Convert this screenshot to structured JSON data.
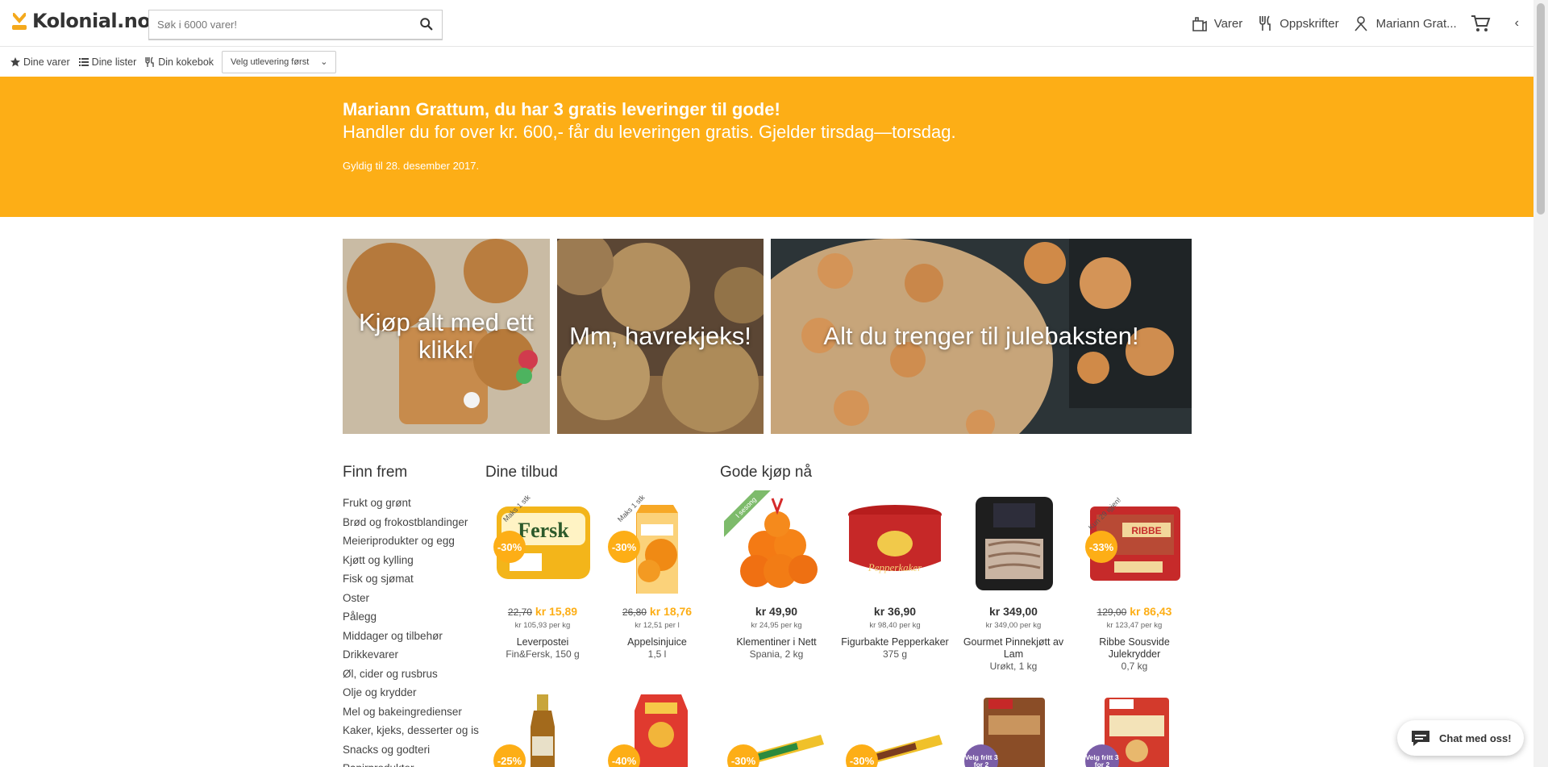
{
  "header": {
    "logo_text": "Kolonial.no",
    "search_placeholder": "Søk i 6000 varer!",
    "nav": [
      {
        "label": "Varer",
        "icon": "grocery-bag-icon"
      },
      {
        "label": "Oppskrifter",
        "icon": "fork-knife-icon"
      },
      {
        "label": "Mariann Grat...",
        "icon": "user-icon"
      }
    ]
  },
  "subbar": {
    "items": [
      "Dine varer",
      "Dine lister",
      "Din kokebok"
    ],
    "delivery_select": "Velg utlevering først"
  },
  "banner": {
    "headline": "Mariann Grattum, du har 3 gratis leveringer til gode!",
    "subline": "Handler du for over kr. 600,- får du leveringen gratis. Gjelder tirsdag—torsdag.",
    "valid": "Gyldig til 28. desember 2017.",
    "color": "#fdae16"
  },
  "hero": [
    {
      "label": "Kjøp alt med ett klikk!"
    },
    {
      "label": "Mm, havrekjeks!"
    },
    {
      "label": "Alt du trenger til julebaksten!"
    }
  ],
  "sections": {
    "finn_frem": "Finn frem",
    "dine_tilbud": "Dine tilbud",
    "gode_kjop": "Gode kjøp nå"
  },
  "categories": [
    "Frukt og grønt",
    "Brød og frokostblandinger",
    "Meieriprodukter og egg",
    "Kjøtt og kylling",
    "Fisk og sjømat",
    "Oster",
    "Pålegg",
    "Middager og tilbehør",
    "Drikkevarer",
    "Øl, cider og rusbrus",
    "Olje og krydder",
    "Mel og bakeingredienser",
    "Kaker, kjeks, desserter og is",
    "Snacks og godteri",
    "Papirprodukter"
  ],
  "products": [
    {
      "ribbon": "Maks 1 stk",
      "discount": "-30%",
      "old_price": "22,70",
      "price": "kr 15,89",
      "unit": "kr 105,93 per kg",
      "name": "Leverpostei",
      "desc": "Fin&Fersk, 150 g"
    },
    {
      "ribbon": "Maks 1 stk",
      "discount": "-30%",
      "old_price": "26,80",
      "price": "kr 18,76",
      "unit": "kr 12,51 per l",
      "name": "Appelsinjuice",
      "desc": "1,5 l"
    },
    {
      "ribbon": "I sesong",
      "discount": "",
      "old_price": "",
      "price": "kr 49,90",
      "unit": "kr 24,95 per kg",
      "name": "Klementiner i Nett",
      "desc": "Spania, 2 kg"
    },
    {
      "ribbon": "",
      "discount": "",
      "old_price": "",
      "price": "kr 36,90",
      "unit": "kr 98,40 per kg",
      "name": "Figurbakte Pepperkaker",
      "desc": "375 g"
    },
    {
      "ribbon": "",
      "discount": "",
      "old_price": "",
      "price": "kr 349,00",
      "unit": "kr 349,00 per kg",
      "name": "Gourmet Pinnekjøtt av Lam",
      "desc": "Urøkt, 1 kg"
    },
    {
      "ribbon": "Kun 29 igjen!",
      "discount": "-33%",
      "old_price": "129,00",
      "price": "kr 86,43",
      "unit": "kr 123,47 per kg",
      "name": "Ribbe Sousvide Julekrydder",
      "desc": "0,7 kg"
    }
  ],
  "row2_discounts": [
    "-25%",
    "-40%",
    "-30%",
    "-30%",
    "Velg fritt 3 for 2",
    "Velg fritt 3 for 2"
  ],
  "chat_label": "Chat med oss!"
}
